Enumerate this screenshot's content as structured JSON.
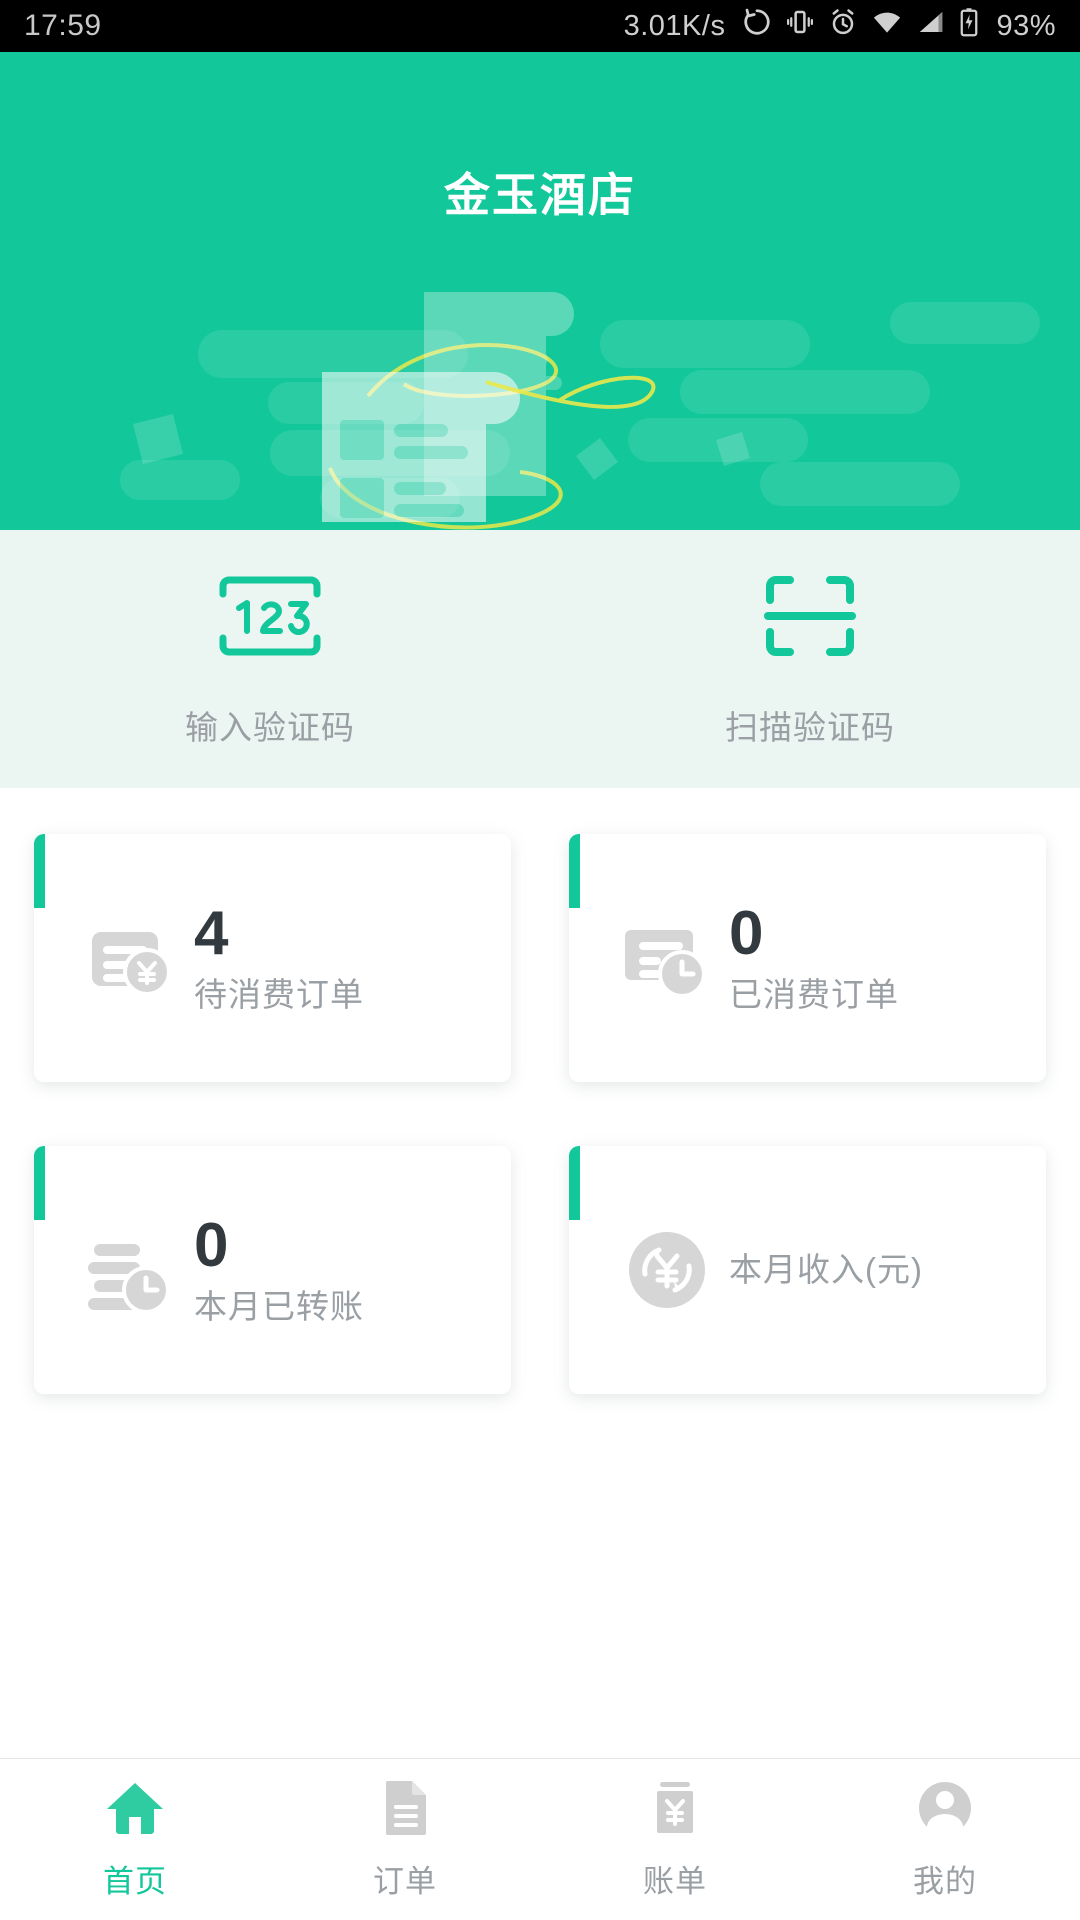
{
  "status_bar": {
    "time": "17:59",
    "network_speed": "3.01K/s",
    "battery_percent": "93%",
    "icons": [
      "sync-icon",
      "vibrate-icon",
      "alarm-icon",
      "wifi-icon",
      "signal-icon",
      "battery-charging-icon"
    ]
  },
  "hero": {
    "title": "金玉酒店",
    "background_color": "#12c79a",
    "illustration": "receipt-invoice-illustration"
  },
  "actions": {
    "background_color": "#ebf5f2",
    "items": [
      {
        "label": "输入验证码",
        "icon": "numeric-code-123-icon"
      },
      {
        "label": "扫描验证码",
        "icon": "scan-qr-frame-icon"
      }
    ]
  },
  "stats": {
    "accent_color": "#12c79a",
    "cards": [
      {
        "value": "4",
        "label": "待消费订单",
        "icon": "card-yen-icon"
      },
      {
        "value": "0",
        "label": "已消费订单",
        "icon": "document-clock-icon"
      },
      {
        "value": "0",
        "label": "本月已转账",
        "icon": "bars-clock-icon"
      },
      {
        "value": "",
        "label": "本月收入(元)",
        "icon": "yen-refresh-circle-icon"
      }
    ]
  },
  "tabbar": {
    "active_color": "#12c79a",
    "inactive_color": "#9a9fa4",
    "items": [
      {
        "label": "首页",
        "icon": "home-icon",
        "active": true
      },
      {
        "label": "订单",
        "icon": "document-icon",
        "active": false
      },
      {
        "label": "账单",
        "icon": "bill-yen-icon",
        "active": false
      },
      {
        "label": "我的",
        "icon": "person-icon",
        "active": false
      }
    ]
  }
}
